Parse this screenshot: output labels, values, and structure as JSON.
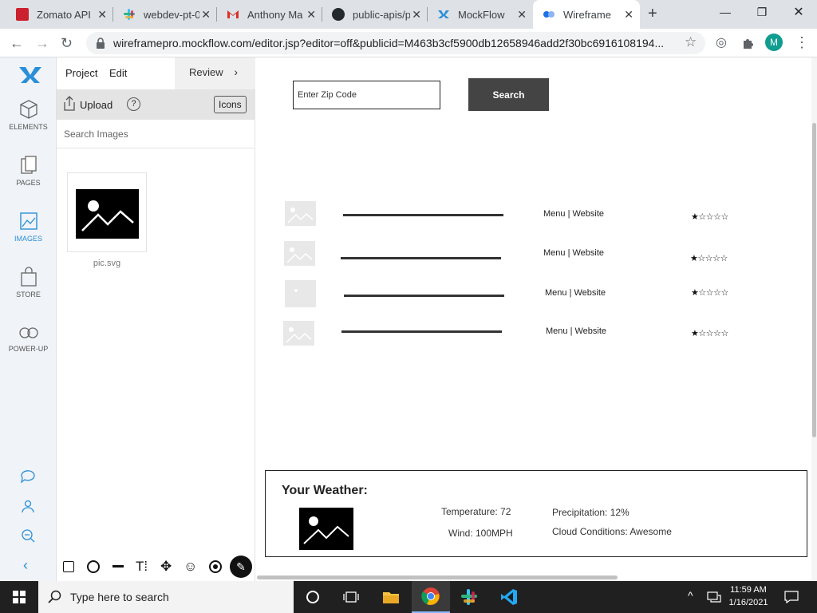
{
  "browser": {
    "tabs": [
      {
        "title": "Zomato API",
        "icon": "zomato-icon"
      },
      {
        "title": "webdev-pt-0",
        "icon": "slack-icon"
      },
      {
        "title": "Anthony Ma",
        "icon": "gmail-icon"
      },
      {
        "title": "public-apis/p",
        "icon": "github-icon"
      },
      {
        "title": "MockFlow",
        "icon": "mockflow-icon"
      },
      {
        "title": "WireframePr",
        "icon": "wireframepro-icon"
      }
    ],
    "url": "wireframepro.mockflow.com/editor.jsp?editor=off&publicid=M463b3cf5900db12658946add2f30bc6916108194...",
    "avatar_letter": "M"
  },
  "rail": {
    "items": [
      {
        "label": "ELEMENTS"
      },
      {
        "label": "PAGES"
      },
      {
        "label": "IMAGES"
      },
      {
        "label": "STORE"
      },
      {
        "label": "POWER-UP"
      }
    ]
  },
  "panel": {
    "project_label": "Project",
    "edit_label": "Edit",
    "review_label": "Review",
    "upload_label": "Upload",
    "help_label": "?",
    "icons_label": "Icons",
    "search_placeholder": "Search Images",
    "image_name": "pic.svg"
  },
  "canvas": {
    "zip_placeholder": "Enter Zip Code",
    "search_label": "Search",
    "results": [
      {
        "links": "Menu | Website",
        "stars": "★☆☆☆☆"
      },
      {
        "links": "Menu | Website",
        "stars": "★☆☆☆☆"
      },
      {
        "links": "Menu | Website",
        "stars": "★☆☆☆☆"
      },
      {
        "links": "Menu | Website",
        "stars": "★☆☆☆☆"
      }
    ],
    "weather": {
      "title": "Your Weather:",
      "temperature": "Temperature:  72",
      "wind": "Wind: 100MPH",
      "precipitation": "Precipitation: 12%",
      "clouds": "Cloud Conditions: Awesome"
    }
  },
  "taskbar": {
    "search_placeholder": "Type here to search",
    "time": "11:59 AM",
    "date": "1/16/2021"
  },
  "colors": {
    "accent": "#2a8fd8",
    "search_button": "#444444",
    "tab_bar": "#dee1e6"
  }
}
